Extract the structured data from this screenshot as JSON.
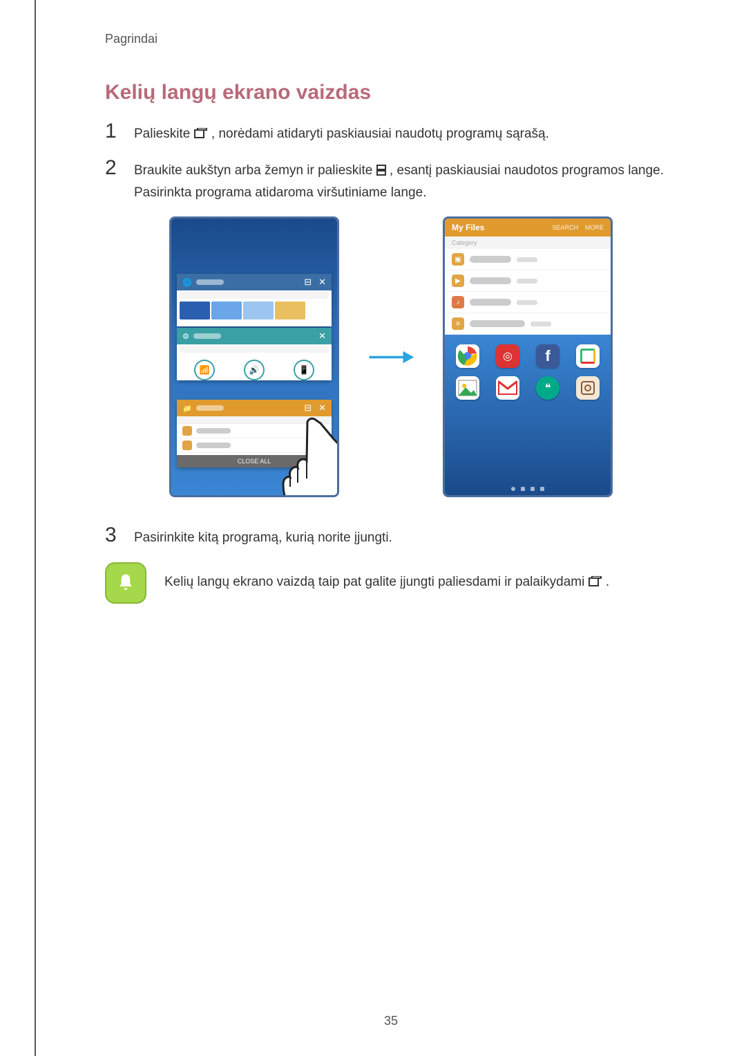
{
  "header": "Pagrindai",
  "title": "Kelių langų ekrano vaizdas",
  "steps": {
    "s1_pre": "Palieskite ",
    "s1_post": ", norėdami atidaryti paskiausiai naudotų programų sąrašą.",
    "s2_pre": "Braukite aukštyn arba žemyn ir palieskite ",
    "s2_post": ", esantį paskiausiai naudotos programos lange. Pasirinkta programa atidaroma viršutiniame lange.",
    "s3": "Pasirinkite kitą programą, kurią norite įjungti."
  },
  "note": {
    "pre": "Kelių langų ekrano vaizdą taip pat galite įjungti paliesdami ir palaikydami ",
    "post": "."
  },
  "figure": {
    "left_phone": {
      "card1_label": "Internet",
      "card2_label": "Settings",
      "card3_label": "My Files",
      "close_all": "CLOSE ALL"
    },
    "right_phone": {
      "mf_title": "My Files",
      "mf_search": "SEARCH",
      "mf_more": "MORE",
      "mf_category": "Category",
      "rows": [
        "Images",
        "Videos",
        "Audio",
        "Documents"
      ]
    }
  },
  "page_number": "35"
}
